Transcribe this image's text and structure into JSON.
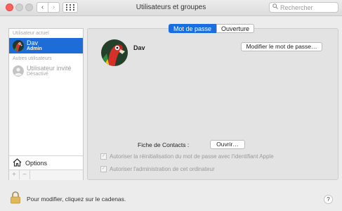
{
  "window": {
    "title": "Utilisateurs et groupes"
  },
  "toolbar": {
    "back_glyph": "‹",
    "forward_glyph": "›",
    "grid_glyph": "⋮⋮⋮"
  },
  "search": {
    "placeholder": "Rechercher"
  },
  "sidebar": {
    "current_user_header": "Utilisateur actuel",
    "current_user": {
      "name": "Dav",
      "role": "Admin"
    },
    "other_users_header": "Autres utilisateurs",
    "guest_user": {
      "name": "Utilisateur invité",
      "status": "Désactivé"
    },
    "options_label": "Options",
    "add_glyph": "+",
    "remove_glyph": "−"
  },
  "tabs": [
    {
      "label": "Mot de passe",
      "active": true
    },
    {
      "label": "Ouverture",
      "active": false
    }
  ],
  "main": {
    "user_name": "Dav",
    "change_password_label": "Modifier le mot de passe…",
    "contacts_label": "Fiche de Contacts :",
    "open_label": "Ouvrir…",
    "checkbox_reset": "Autoriser la réinitialisation du mot de passe avec l'identifiant Apple",
    "checkbox_admin": "Autoriser l'administration de cet ordinateur"
  },
  "footer": {
    "lock_text": "Pour modifier, cliquez sur le cadenas.",
    "help_label": "?"
  },
  "colors": {
    "selection": "#1d6cd8",
    "tab_active": "#1b6ee0",
    "close": "#fc605b"
  }
}
